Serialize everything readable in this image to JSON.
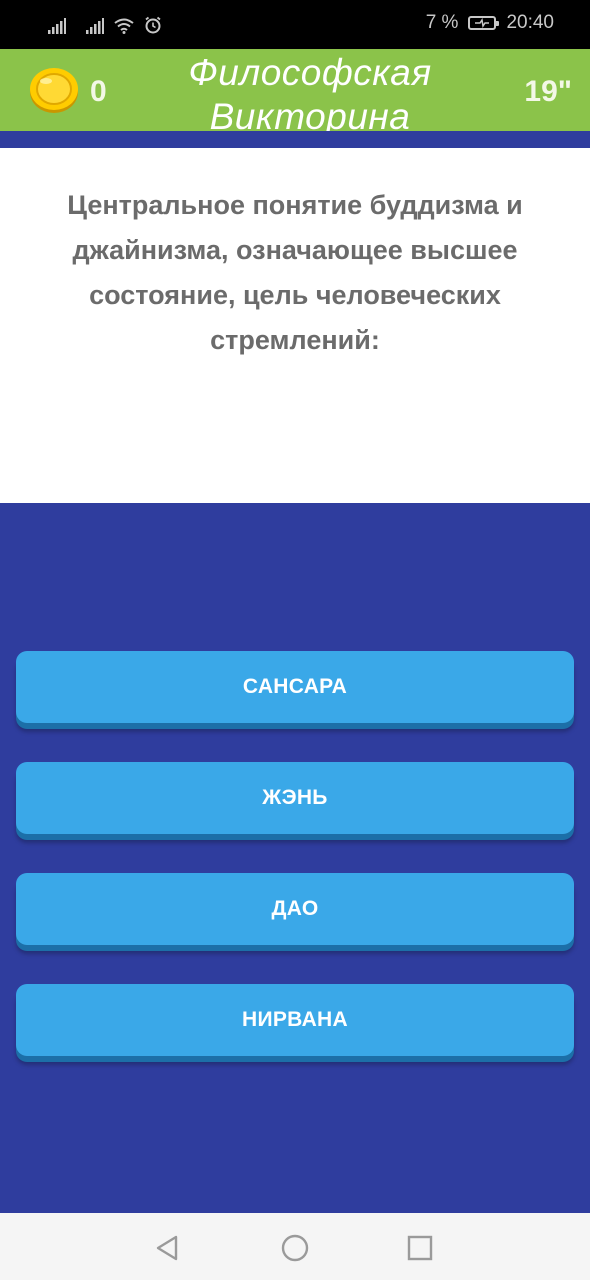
{
  "status_bar": {
    "battery_percent": "7 %",
    "time": "20:40",
    "icons": [
      "signal-icon",
      "signal-icon",
      "wifi-icon",
      "alarm-icon",
      "battery-charging-icon"
    ]
  },
  "header": {
    "coins": "0",
    "title": "Философская Викторина",
    "timer": "19\"",
    "icon": "coin-icon"
  },
  "question": {
    "text": "Центральное понятие буддизма и джайнизма, означающее высшее состояние, цель человеческих стремлений:"
  },
  "answers": [
    {
      "label": "САНСАРА"
    },
    {
      "label": "ЖЭНЬ"
    },
    {
      "label": "ДАО"
    },
    {
      "label": "НИРВАНА"
    }
  ],
  "nav_bar": {
    "icons": [
      "back-icon",
      "home-icon",
      "recents-icon"
    ]
  },
  "colors": {
    "header_green": "#8bc34a",
    "background_blue": "#2f3d9e",
    "answer_button": "#3aa8e8",
    "question_text": "#6b6b6b"
  }
}
